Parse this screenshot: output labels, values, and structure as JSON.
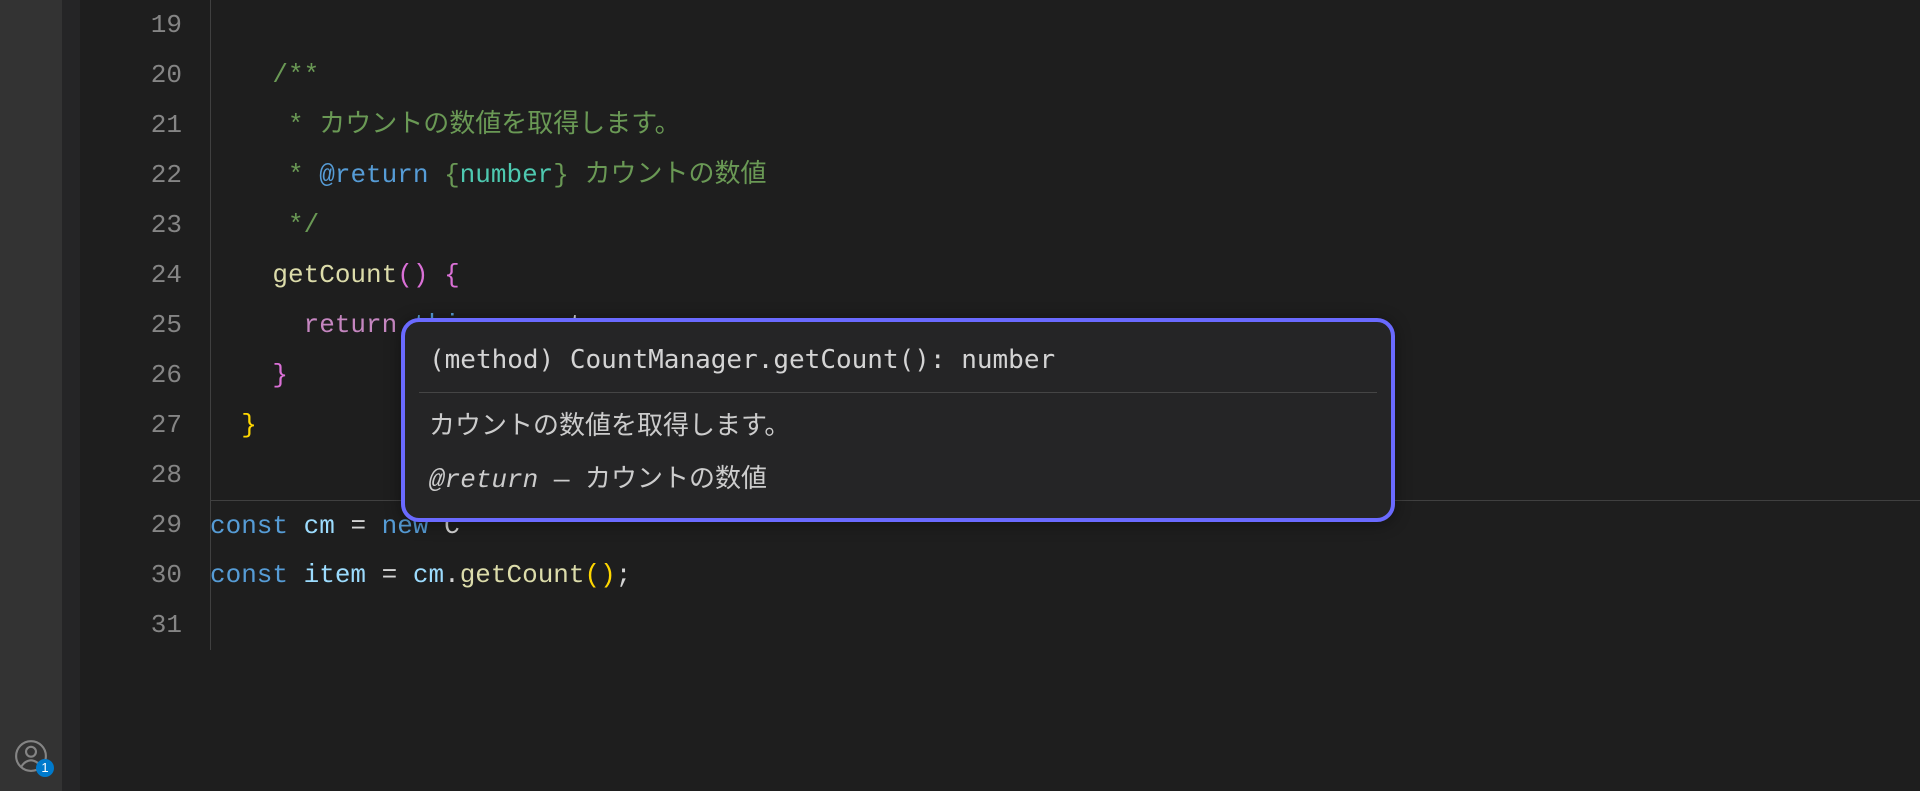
{
  "activity_bar": {
    "account_badge": "1"
  },
  "gutter": {
    "line_numbers": [
      "19",
      "20",
      "21",
      "22",
      "23",
      "24",
      "25",
      "26",
      "27",
      "28",
      "29",
      "30",
      "31"
    ]
  },
  "code": {
    "lines": [
      {
        "n": 19,
        "tokens": []
      },
      {
        "n": 20,
        "tokens": [
          {
            "t": "    ",
            "c": "tok-default"
          },
          {
            "t": "/**",
            "c": "tok-comment"
          }
        ]
      },
      {
        "n": 21,
        "tokens": [
          {
            "t": "     ",
            "c": "tok-default"
          },
          {
            "t": "* カウントの数値を取得します。",
            "c": "tok-comment"
          }
        ]
      },
      {
        "n": 22,
        "tokens": [
          {
            "t": "     ",
            "c": "tok-default"
          },
          {
            "t": "* ",
            "c": "tok-comment"
          },
          {
            "t": "@return",
            "c": "tok-doctag"
          },
          {
            "t": " ",
            "c": "tok-comment"
          },
          {
            "t": "{",
            "c": "tok-comment"
          },
          {
            "t": "number",
            "c": "tok-doctype"
          },
          {
            "t": "}",
            "c": "tok-comment"
          },
          {
            "t": " カウントの数値",
            "c": "tok-comment"
          }
        ]
      },
      {
        "n": 23,
        "tokens": [
          {
            "t": "     ",
            "c": "tok-default"
          },
          {
            "t": "*/",
            "c": "tok-comment"
          }
        ]
      },
      {
        "n": 24,
        "tokens": [
          {
            "t": "    ",
            "c": "tok-default"
          },
          {
            "t": "getCount",
            "c": "tok-func"
          },
          {
            "t": "()",
            "c": "tok-brace-pink"
          },
          {
            "t": " ",
            "c": "tok-default"
          },
          {
            "t": "{",
            "c": "tok-brace-pink"
          }
        ]
      },
      {
        "n": 25,
        "tokens": [
          {
            "t": "      ",
            "c": "tok-default"
          },
          {
            "t": "return",
            "c": "tok-keyword2"
          },
          {
            "t": " ",
            "c": "tok-default"
          },
          {
            "t": "this",
            "c": "tok-this"
          },
          {
            "t": "._count;",
            "c": "tok-default"
          }
        ]
      },
      {
        "n": 26,
        "tokens": [
          {
            "t": "    ",
            "c": "tok-default"
          },
          {
            "t": "}",
            "c": "tok-brace-pink"
          }
        ]
      },
      {
        "n": 27,
        "tokens": [
          {
            "t": "  ",
            "c": "tok-default"
          },
          {
            "t": "}",
            "c": "tok-brace-yel"
          }
        ]
      },
      {
        "n": 28,
        "tokens": []
      },
      {
        "n": 29,
        "tokens": [
          {
            "t": "const",
            "c": "tok-keyword"
          },
          {
            "t": " ",
            "c": "tok-default"
          },
          {
            "t": "cm",
            "c": "tok-var"
          },
          {
            "t": " = ",
            "c": "tok-default"
          },
          {
            "t": "new",
            "c": "tok-keyword"
          },
          {
            "t": " C",
            "c": "tok-default"
          }
        ]
      },
      {
        "n": 30,
        "tokens": [
          {
            "t": "const",
            "c": "tok-keyword"
          },
          {
            "t": " ",
            "c": "tok-default"
          },
          {
            "t": "item",
            "c": "tok-var"
          },
          {
            "t": " = ",
            "c": "tok-default"
          },
          {
            "t": "cm",
            "c": "tok-var"
          },
          {
            "t": ".",
            "c": "tok-default"
          },
          {
            "t": "getCount",
            "c": "tok-func"
          },
          {
            "t": "()",
            "c": "tok-brace-yel"
          },
          {
            "t": ";",
            "c": "tok-default"
          }
        ]
      },
      {
        "n": 31,
        "tokens": []
      }
    ]
  },
  "hover": {
    "signature": "(method) CountManager.getCount(): number",
    "description": "カウントの数値を取得します。",
    "return_tag": "@return",
    "return_sep": " — ",
    "return_text": "カウントの数値"
  }
}
